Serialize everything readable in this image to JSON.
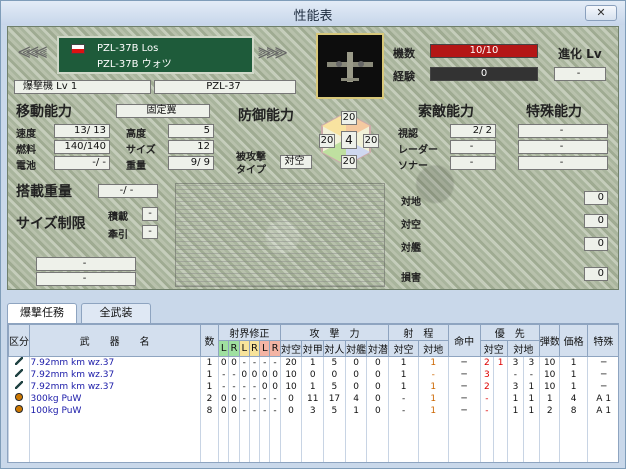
{
  "window": {
    "title": "性能表",
    "close": "✕"
  },
  "aircraft": {
    "name_line1": "PZL-37B Los",
    "name_line2": "PZL-37B ウォツ",
    "type_label": "爆撃機 Lv 1",
    "model": "PZL-37"
  },
  "status": {
    "hp_label": "機数",
    "hp": "10/10",
    "exp_label": "経験",
    "exp": "0",
    "evo_label": "進化 Lv",
    "evo": "-"
  },
  "movement": {
    "title": "移動能力",
    "wing_type": "固定翼",
    "speed_label": "速度",
    "speed": "13/ 13",
    "alt_label": "高度",
    "alt": "5",
    "fuel_label": "燃料",
    "fuel": "140/140",
    "size_label": "サイズ",
    "size": "12",
    "battery_label": "電池",
    "battery": "-/ -",
    "weight_label": "重量",
    "weight": "9/ 9"
  },
  "defense": {
    "title": "防御能力",
    "top": "20",
    "left": "20",
    "center": "4",
    "right": "20",
    "bottom": "20",
    "type_label1": "被攻撃",
    "type_label2": "タイプ",
    "type": "対空"
  },
  "sensor": {
    "title": "索敵能力",
    "visual_label": "視認",
    "visual": "2/ 2",
    "radar_label": "レーダー",
    "radar": "-",
    "sonar_label": "ソナー",
    "sonar": "-"
  },
  "special": {
    "title": "特殊能力",
    "rows": [
      "-",
      "-",
      "-"
    ]
  },
  "payload": {
    "title": "搭載重量",
    "value": "-/ -",
    "size_title": "サイズ制限",
    "carry_label": "積載",
    "carry": "-",
    "tow_label": "牽引",
    "tow": "-",
    "blank1": "-",
    "blank2": "-"
  },
  "attack": {
    "ground_label": "対地",
    "ground": "0",
    "air_label": "対空",
    "air": "0",
    "ship_label": "対艦",
    "ship": "0",
    "dmg_label": "損害",
    "dmg": "0"
  },
  "tabs": [
    "爆撃任務",
    "全武装"
  ],
  "table_headers": {
    "col1": "区分",
    "weapon": "武　　器　　名",
    "count": "数",
    "fire": "射界修正",
    "lr": [
      "L",
      "R",
      "L",
      "R",
      "L",
      "R"
    ],
    "atk": "攻　撃　力",
    "atk_sub": [
      "対空",
      "対甲",
      "対人",
      "対艦",
      "対潜"
    ],
    "range": "射　程",
    "range_sub": [
      "対空",
      "対地"
    ],
    "acc": "命中",
    "prio": "優　先",
    "prio_sub": [
      "対空",
      "対地"
    ],
    "ammo": "弾数",
    "price": "価格",
    "special": "特殊"
  },
  "rows": [
    {
      "icon": "gun",
      "name": "7.92mm km wz.37",
      "count": "1",
      "lr": [
        "0",
        "0",
        "-",
        "-",
        "-",
        "-"
      ],
      "atk": [
        "20",
        "1",
        "5",
        "0",
        "0"
      ],
      "r_air": "1",
      "r_gnd": "1",
      "acc": "─",
      "p_air": "2",
      "p_air2": "1",
      "p_gnd": "3",
      "p_gnd2": "3",
      "ammo": "10",
      "price": "1",
      "sp": "─"
    },
    {
      "icon": "gun",
      "name": "7.92mm km wz.37",
      "count": "1",
      "lr": [
        "-",
        "-",
        "0",
        "0",
        "0",
        "0"
      ],
      "atk": [
        "10",
        "0",
        "0",
        "0",
        "0"
      ],
      "r_air": "1",
      "r_gnd": "-",
      "acc": "─",
      "p_air": "3",
      "p_air2": "",
      "p_gnd": "-",
      "p_gnd2": "-",
      "ammo": "10",
      "price": "1",
      "sp": "─"
    },
    {
      "icon": "gun",
      "name": "7.92mm km wz.37",
      "count": "1",
      "lr": [
        "-",
        "-",
        "-",
        "-",
        "0",
        "0"
      ],
      "atk": [
        "10",
        "1",
        "5",
        "0",
        "0"
      ],
      "r_air": "1",
      "r_gnd": "1",
      "acc": "─",
      "p_air": "2",
      "p_air2": "",
      "p_gnd": "3",
      "p_gnd2": "1",
      "ammo": "10",
      "price": "1",
      "sp": "─"
    },
    {
      "icon": "bomb",
      "name": "300kg PuW",
      "count": "2",
      "lr": [
        "0",
        "0",
        "-",
        "-",
        "-",
        "-"
      ],
      "atk": [
        "0",
        "11",
        "17",
        "4",
        "0"
      ],
      "r_air": "-",
      "r_gnd": "1",
      "acc": "─",
      "p_air": "-",
      "p_air2": "",
      "p_gnd": "1",
      "p_gnd2": "1",
      "ammo": "1",
      "price": "4",
      "sp": "A 1"
    },
    {
      "icon": "bomb",
      "name": "100kg PuW",
      "count": "8",
      "lr": [
        "0",
        "0",
        "-",
        "-",
        "-",
        "-"
      ],
      "atk": [
        "0",
        "3",
        "5",
        "1",
        "0"
      ],
      "r_air": "-",
      "r_gnd": "1",
      "acc": "─",
      "p_air": "-",
      "p_air2": "",
      "p_gnd": "1",
      "p_gnd2": "1",
      "ammo": "2",
      "price": "8",
      "sp": "A 1"
    }
  ]
}
